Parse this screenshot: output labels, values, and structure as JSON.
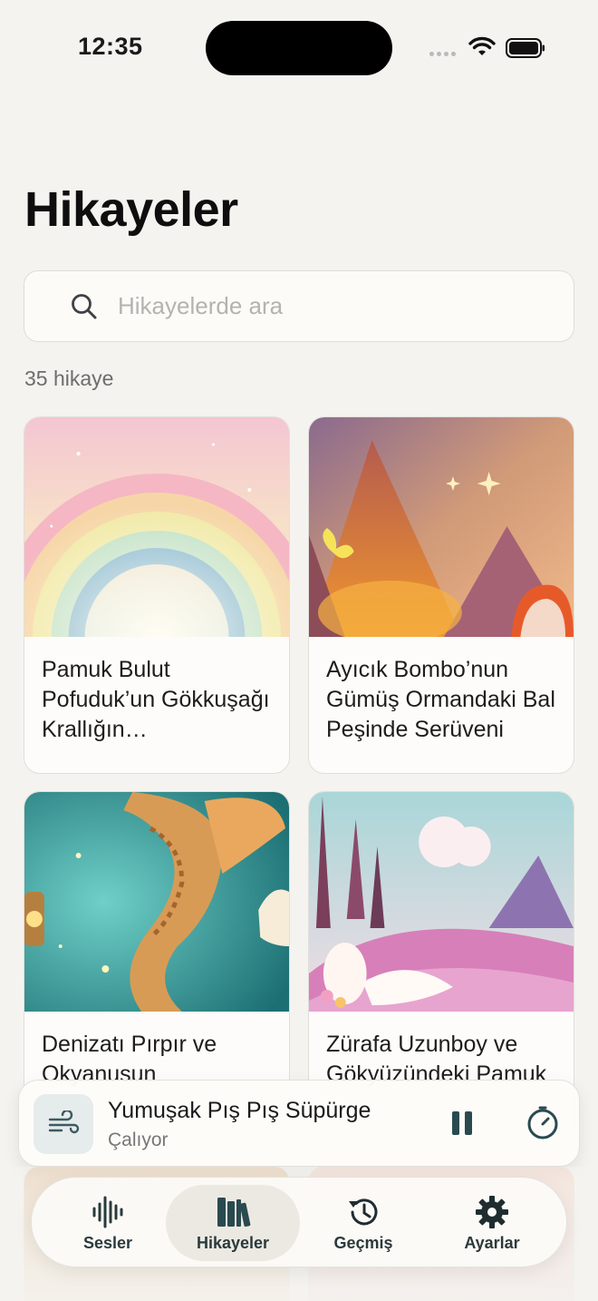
{
  "status_bar": {
    "time": "12:35"
  },
  "page": {
    "title": "Hikayeler"
  },
  "search": {
    "placeholder": "Hikayelerde ara"
  },
  "story_count": "35 hikaye",
  "stories": [
    {
      "title": "Pamuk Bulut Pofuduk’un Gökkuşağı Krallığın…",
      "art": "rainbow"
    },
    {
      "title": "Ayıcık Bombo’nun Gümüş Ormandaki Bal Peşinde Serüveni",
      "art": "mountains"
    },
    {
      "title": "Denizatı Pırpır ve Okyanusun",
      "art": "seahorse"
    },
    {
      "title": "Zürafa Uzunboy ve Gökyüzündeki Pamuk",
      "art": "valley"
    }
  ],
  "now_playing": {
    "title": "Yumuşak Pış Pış Süpürge",
    "status": "Çalıyor",
    "thumb_icon": "wind-icon"
  },
  "tabs": [
    {
      "label": "Sesler",
      "icon": "waveform-icon"
    },
    {
      "label": "Hikayeler",
      "icon": "books-icon",
      "active": true
    },
    {
      "label": "Geçmiş",
      "icon": "history-icon"
    },
    {
      "label": "Ayarlar",
      "icon": "gear-icon"
    }
  ],
  "colors": {
    "background": "#f4f3ef",
    "accent": "#2a4a50"
  }
}
